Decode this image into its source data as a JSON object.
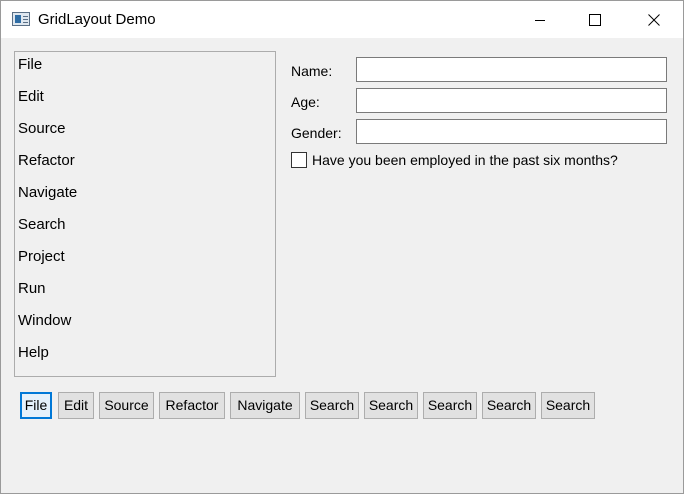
{
  "window": {
    "title": "GridLayout Demo"
  },
  "menu_list": {
    "items": [
      "File",
      "Edit",
      "Source",
      "Refactor",
      "Navigate",
      "Search",
      "Project",
      "Run",
      "Window",
      "Help"
    ]
  },
  "form": {
    "name_label": "Name:",
    "name_value": "",
    "age_label": "Age:",
    "age_value": "",
    "gender_label": "Gender:",
    "gender_value": "",
    "employed_label": "Have you been employed in the past six months?",
    "employed_checked": false
  },
  "buttons": [
    "File",
    "Edit",
    "Source",
    "Refactor",
    "Navigate",
    "Search",
    "Search",
    "Search",
    "Search",
    "Search"
  ],
  "colors": {
    "focus_border": "#0078d7",
    "window_bg": "#f0f0f0",
    "button_bg": "#e1e1e1"
  }
}
